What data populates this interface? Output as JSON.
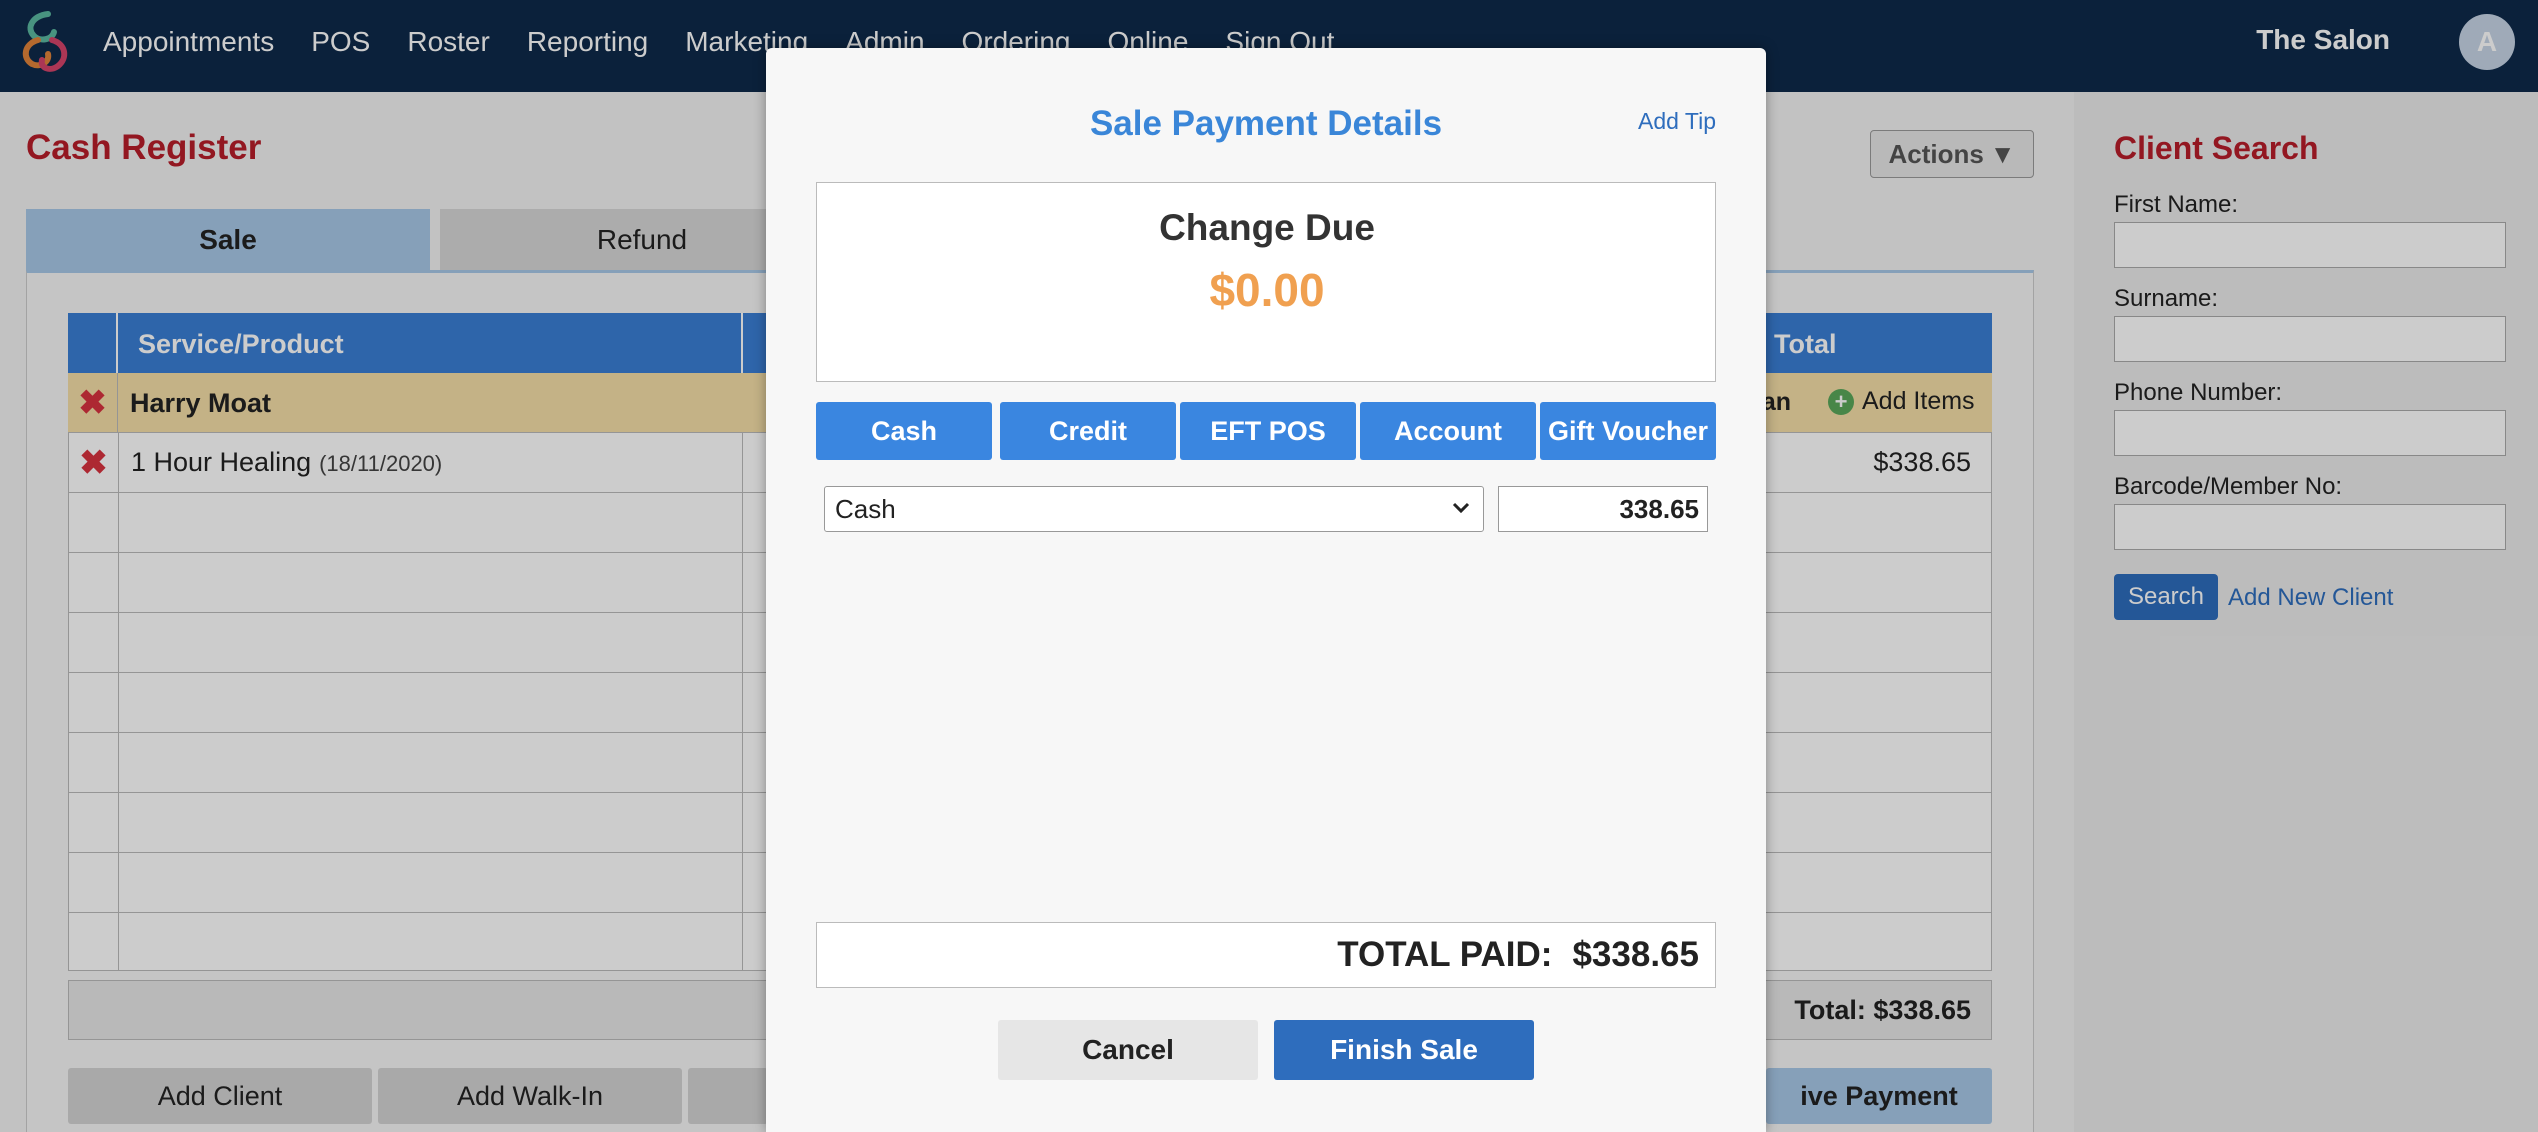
{
  "nav": {
    "links": [
      "Appointments",
      "POS",
      "Roster",
      "Reporting",
      "Marketing",
      "Admin",
      "Ordering",
      "Online",
      "Sign Out"
    ],
    "salon_name": "The Salon",
    "avatar_initial": "A"
  },
  "register": {
    "title": "Cash Register",
    "actions_label": "Actions",
    "tabs": [
      "Sale",
      "Refund"
    ],
    "columns": {
      "service": "Service/Product",
      "total": "Total"
    },
    "client_name": "Harry Moat",
    "scan_label": "can",
    "add_items_label": "Add Items",
    "items": [
      {
        "name": "1 Hour Healing",
        "date": "(18/11/2020)",
        "total": "$338.65"
      }
    ],
    "footer_total": "Total: $338.65",
    "bottom_buttons": {
      "add_client": "Add Client",
      "add_walkin": "Add Walk-In",
      "receive_payment": "ive Payment"
    }
  },
  "client_search": {
    "title": "Client Search",
    "first_name": "First Name:",
    "surname": "Surname:",
    "phone": "Phone Number:",
    "barcode": "Barcode/Member No:",
    "search_label": "Search",
    "add_new_label": "Add New Client"
  },
  "modal": {
    "title": "Sale Payment Details",
    "add_tip": "Add Tip",
    "change_label": "Change Due",
    "change_amount": "$0.00",
    "methods": [
      "Cash",
      "Credit",
      "EFT POS",
      "Account",
      "Gift Voucher"
    ],
    "selected_method": "Cash",
    "amount": "338.65",
    "total_paid_label": "TOTAL PAID:",
    "total_paid_value": "$338.65",
    "cancel_label": "Cancel",
    "finish_label": "Finish Sale"
  },
  "colors": {
    "nav_bg": "#0e2a4a",
    "accent_blue": "#3a86e0",
    "title_red": "#b81d2a",
    "change_orange": "#f0a050"
  }
}
